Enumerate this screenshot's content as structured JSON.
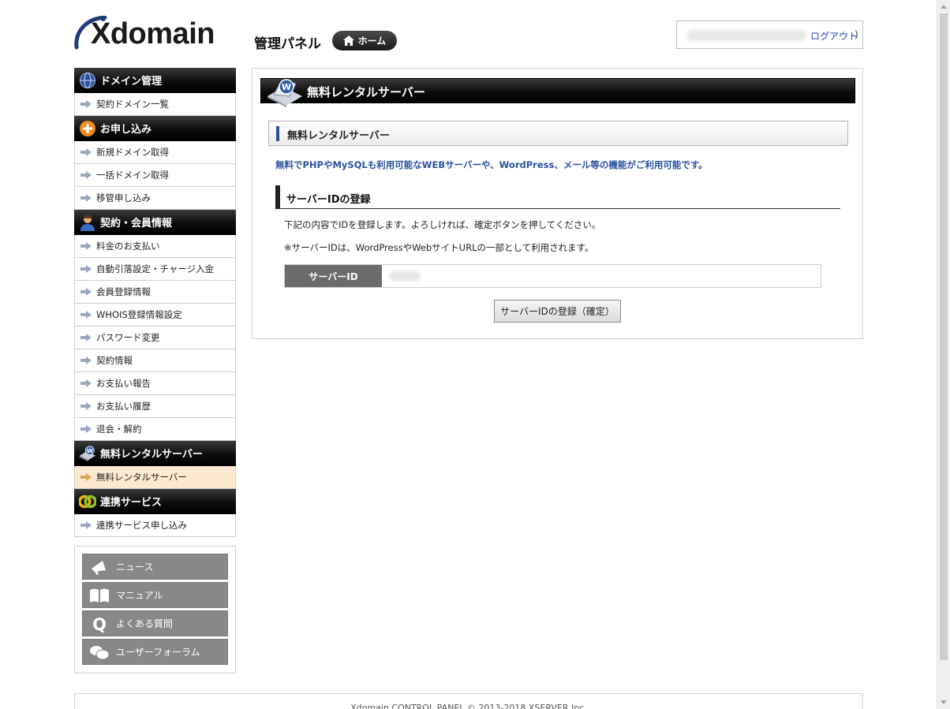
{
  "header": {
    "logo_text": "Xdomain",
    "panel_title": "管理パネル",
    "home_label": "ホーム",
    "logout_label": "ログアウト",
    "logout_suffix": ")"
  },
  "sidebar": {
    "sections": [
      {
        "title": "ドメイン管理",
        "icon": "globe-icon",
        "items": [
          "契約ドメイン一覧"
        ]
      },
      {
        "title": "お申し込み",
        "icon": "plus-circle-icon",
        "items": [
          "新規ドメイン取得",
          "一括ドメイン取得",
          "移管申し込み"
        ]
      },
      {
        "title": "契約・会員情報",
        "icon": "user-icon",
        "items": [
          "料金のお支払い",
          "自動引落設定・チャージ入金",
          "会員登録情報",
          "WHOIS登録情報設定",
          "パスワード変更",
          "契約情報",
          "お支払い報告",
          "お支払い履歴",
          "退会・解約"
        ]
      },
      {
        "title": "無料レンタルサーバー",
        "icon": "server-icon",
        "items": [
          "無料レンタルサーバー"
        ]
      },
      {
        "title": "連携サービス",
        "icon": "link-icon",
        "items": [
          "連携サービス申し込み"
        ]
      }
    ],
    "sub_buttons": [
      {
        "label": "ニュース",
        "icon": "megaphone-icon"
      },
      {
        "label": "マニュアル",
        "icon": "book-icon"
      },
      {
        "label": "よくある質問",
        "icon": "question-icon"
      },
      {
        "label": "ユーザーフォーラム",
        "icon": "chat-bubbles-icon"
      }
    ]
  },
  "main": {
    "header_title": "無料レンタルサーバー",
    "box_title": "無料レンタルサーバー",
    "description": "無料でPHPやMySQLも利用可能なWEBサーバーや、WordPress、メール等の機能がご利用可能です。",
    "section_title": "サーバーIDの登録",
    "para1": "下記の内容でIDを登録します。よろしければ、確定ボタンを押してください。",
    "para2": "※サーバーIDは、WordPressやWebサイトURLの一部として利用されます。",
    "form_label": "サーバーID",
    "submit_label": "サーバーIDの登録（確定）"
  },
  "footer": {
    "text": "Xdomain CONTROL PANEL © 2013-2018 XSERVER Inc."
  },
  "colors": {
    "accent_blue": "#2b51a0",
    "active_item_bg": "#fbe8cf",
    "header_black": "#000000"
  }
}
